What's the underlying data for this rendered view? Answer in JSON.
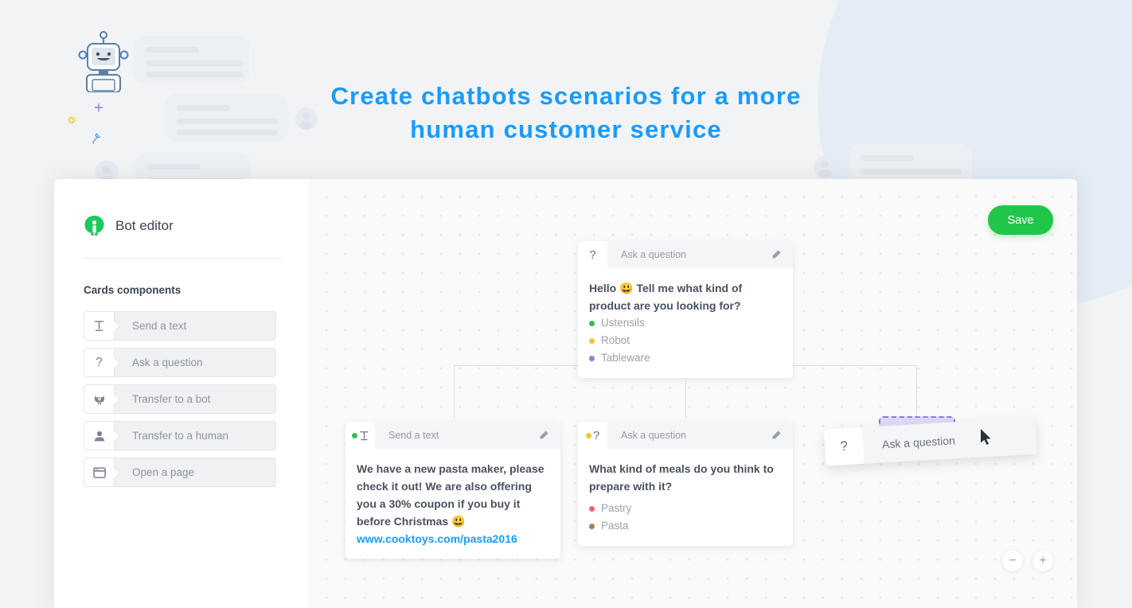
{
  "headline": {
    "line1": "Create chatbots scenarios for a more",
    "line2": "human customer service",
    "color": "#1a9bfc"
  },
  "sidebar": {
    "brand": "Bot editor",
    "logo_icon": "bot-logo-icon",
    "section_title": "Cards components",
    "components": [
      {
        "icon": "text-format-icon",
        "label": "Send a text"
      },
      {
        "icon": "question-mark-icon",
        "label": "Ask a question"
      },
      {
        "icon": "robot-icon",
        "label": "Transfer to a bot"
      },
      {
        "icon": "person-icon",
        "label": "Transfer to a human"
      },
      {
        "icon": "browser-window-icon",
        "label": "Open a page"
      }
    ]
  },
  "canvas": {
    "save_label": "Save",
    "save_color": "#20c649",
    "zoom_out_label": "−",
    "zoom_in_label": "+",
    "cards": [
      {
        "id": "root-question",
        "type_icon": "question-mark-icon",
        "header": "Ask a question",
        "edit_icon": "pencil-icon",
        "text": "Hello 😃 Tell me what kind of product are you looking for?",
        "options": [
          {
            "label": "Ustensils",
            "color": "#2fbf4f"
          },
          {
            "label": "Robot",
            "color": "#f7c52b"
          },
          {
            "label": "Tableware",
            "color": "#8b7ede"
          }
        ]
      },
      {
        "id": "send-text",
        "type_icon": "text-format-icon",
        "status_dot": "#2fbf4f",
        "header": "Send a text",
        "edit_icon": "pencil-icon",
        "text": "We have a new pasta maker, please check it out! We are also offering you a 30% coupon if you buy it before Christmas 😃",
        "link": "www.cooktoys.com/pasta2016",
        "options": []
      },
      {
        "id": "meals-question",
        "type_icon": "question-mark-icon",
        "status_dot": "#f7c52b",
        "header": "Ask a question",
        "edit_icon": "pencil-icon",
        "text": "What kind of meals do you think to prepare with it?",
        "options": [
          {
            "label": "Pastry",
            "color": "#f4616a"
          },
          {
            "label": "Pasta",
            "color": "#a97c50"
          }
        ]
      }
    ],
    "drag_card": {
      "type_icon": "question-mark-icon",
      "label": "Ask a question",
      "glyph": "?"
    },
    "drop_target_color": "#8b7ede",
    "cursor_icon": "mouse-pointer-icon"
  }
}
